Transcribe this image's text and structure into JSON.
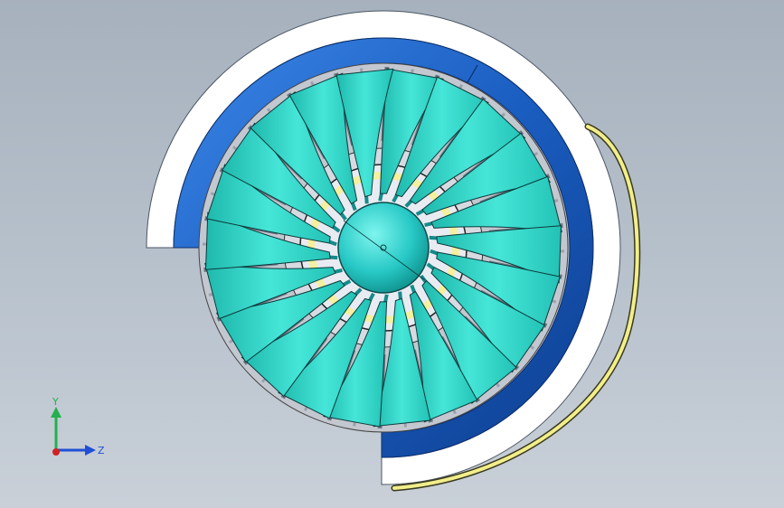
{
  "viewport": {
    "background_top": "#a6b1bd",
    "background_bottom": "#c9d0d8"
  },
  "model": {
    "blade_count": 22,
    "hub_color": "#2fd1cf",
    "blade_color": "#3fe0d4",
    "blade_edge_color": "#0c3b3b",
    "casing_blue": "#1f63c4",
    "casing_white": "#ffffff",
    "yellow_duct": "#f2ee8a",
    "stator_color": "#8d93a0",
    "inner_ring_yellow": "#f4f0a0"
  },
  "triad": {
    "y_label": "Y",
    "z_label": "Z",
    "y_color": "#22b14c",
    "z_color": "#1f4fd6",
    "x_color": "#d42020"
  }
}
